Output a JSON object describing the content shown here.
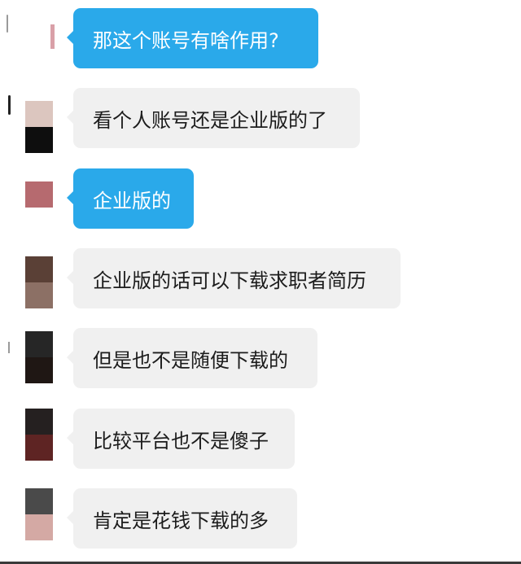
{
  "messages": [
    {
      "text": "那这个账号有啥作用?",
      "type": "sent"
    },
    {
      "text": "看个人账号还是企业版的了",
      "type": "received"
    },
    {
      "text": "企业版的",
      "type": "sent"
    },
    {
      "text": "企业版的话可以下载求职者简历",
      "type": "received"
    },
    {
      "text": "但是也不是随便下载的",
      "type": "received"
    },
    {
      "text": "比较平台也不是傻子",
      "type": "received"
    },
    {
      "text": "肯定是花钱下载的多",
      "type": "received"
    }
  ],
  "colors": {
    "sent_bubble": "#2aa9ea",
    "received_bubble": "#f0f0f0",
    "background": "#ffffff"
  }
}
